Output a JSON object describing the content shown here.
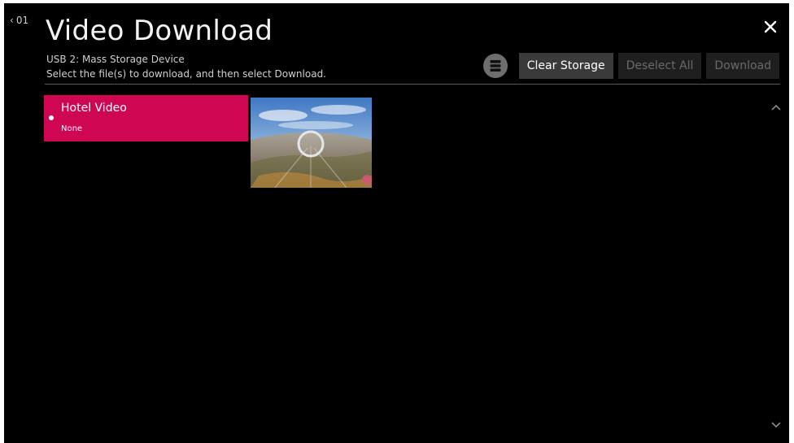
{
  "header": {
    "back_label": "01",
    "title": "Video Download",
    "device": "USB 2: Mass Storage Device",
    "instructions": "Select the file(s) to download, and then select Download."
  },
  "toolbar": {
    "storage_icon": "storage-icon",
    "clear_label": "Clear Storage",
    "deselect_label": "Deselect All",
    "download_label": "Download"
  },
  "files": [
    {
      "name": "Hotel Video",
      "status": "None",
      "selected": true
    }
  ],
  "colors": {
    "accent": "#cf0652",
    "background": "#000000",
    "button": "#3a3a3a",
    "button_disabled": "#1f1f1f"
  }
}
